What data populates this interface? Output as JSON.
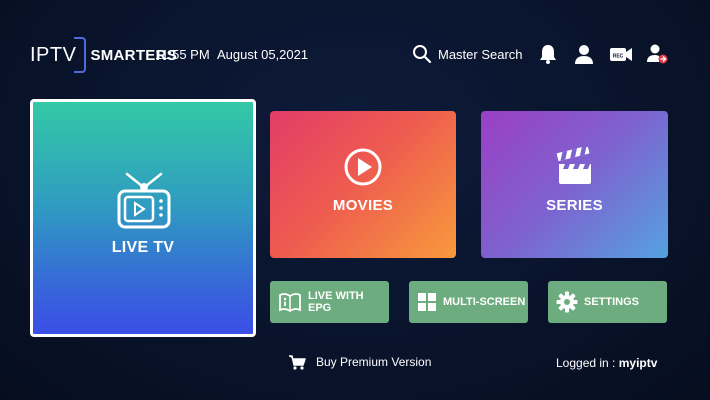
{
  "header": {
    "logo_iptv": "IPTV",
    "logo_smarters": "SMARTERS",
    "time": "11:55 PM",
    "date": "August 05,2021",
    "search_label": "Master Search",
    "icons": [
      "bell-icon",
      "user-icon",
      "record-icon",
      "switch-user-icon"
    ]
  },
  "tiles": {
    "live_tv": "LIVE TV",
    "movies": "MOVIES",
    "series": "SERIES"
  },
  "buttons": {
    "live_with_epg_line1": "LIVE WITH",
    "live_with_epg_line2": "EPG",
    "multi_screen": "MULTI-SCREEN",
    "settings": "SETTINGS"
  },
  "footer": {
    "premium": "Buy Premium Version",
    "logged_in_label": "Logged in :",
    "username": "myiptv"
  },
  "colors": {
    "background": "#09142c",
    "button_green": "#6cac7e",
    "live_gradient": [
      "#33c9a6",
      "#3a4fe6"
    ],
    "movies_gradient": [
      "#e23c68",
      "#f79a3c"
    ],
    "series_gradient": [
      "#9b3fc4",
      "#55a2e0"
    ]
  }
}
